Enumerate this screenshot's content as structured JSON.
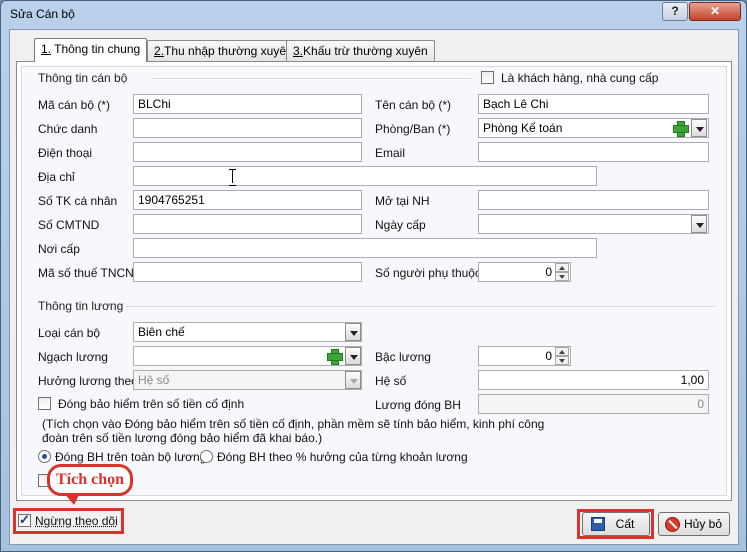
{
  "window": {
    "title": "Sửa Cán bộ",
    "help": "?",
    "close": "✕"
  },
  "tabs": [
    {
      "num": "1.",
      "label": " Thông tin chung"
    },
    {
      "num": "2.",
      "label": "Thu nhập thường xuyên"
    },
    {
      "num": "3.",
      "label": "Khấu trừ thường xuyên"
    }
  ],
  "staff_info": {
    "section": "Thông tin cán bộ",
    "is_customer_label": "Là khách hàng, nhà cung cấp",
    "code_label": "Mã cán bộ (*)",
    "code_value": "BLChi",
    "name_label": "Tên cán bộ (*)",
    "name_value": "Bạch Lê Chi",
    "title_label": "Chức danh",
    "title_value": "",
    "dept_label": "Phòng/Ban (*)",
    "dept_value": "Phòng Kế toán",
    "phone_label": "Điện thoại",
    "phone_value": "",
    "email_label": "Email",
    "email_value": "",
    "address_label": "Địa chỉ",
    "address_value": "",
    "account_label": "Số TK cá nhân",
    "account_value": "1904765251",
    "bank_label": "Mở tại NH",
    "bank_value": "",
    "id_label": "Số CMTND",
    "id_value": "",
    "issue_date_label": "Ngày cấp",
    "issue_date_value": "",
    "issue_place_label": "Nơi cấp",
    "issue_place_value": "",
    "tax_label": "Mã số thuế TNCN",
    "tax_value": "",
    "dependents_label": "Số người phụ thuộc",
    "dependents_value": "0"
  },
  "salary_info": {
    "section": "Thông tin lương",
    "type_label": "Loại cán bộ",
    "type_value": "Biên chế",
    "grade_label": "Ngạch lương",
    "grade_value": "",
    "step_label": "Bậc lương",
    "step_value": "0",
    "mode_label": "Hưởng lương theo",
    "mode_value": "Hệ số",
    "coef_label": "Hệ số",
    "coef_value": "1,00",
    "fixed_insurance_label": "Đóng bảo hiểm trên số tiền cố định",
    "insurance_salary_label": "Lương đóng BH",
    "insurance_salary_value": "0",
    "note": "(Tích chọn vào Đóng bảo hiểm trên số tiền cố định, phần mềm sẽ tính bảo hiểm, kinh phí công đoàn trên số tiền lương đóng bảo hiểm đã khai báo.)",
    "radio_full": "Đóng BH trên toàn bộ lương",
    "radio_percent": "Đóng BH theo % hưởng của từng khoản lương"
  },
  "footer": {
    "callout": "Tích chọn",
    "stop_tracking_label": "Ngừng theo dõi",
    "save_label": "Cất",
    "cancel_label": "Hủy bỏ"
  },
  "colors": {
    "highlight": "#d9342c",
    "add_icon": "#3ea43a"
  }
}
